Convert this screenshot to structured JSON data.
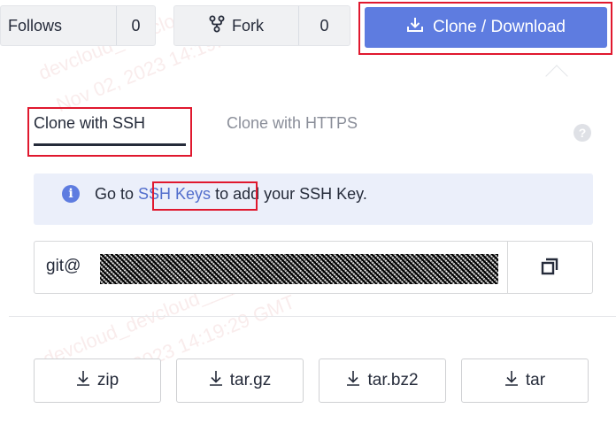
{
  "toolbar": {
    "follows_label": "Follows",
    "follows_count": "0",
    "fork_label": "Fork",
    "fork_count": "0",
    "clone_label": "Clone / Download"
  },
  "popover": {
    "tabs": [
      "Clone with SSH",
      "Clone with HTTPS"
    ],
    "active_tab": "Clone with SSH",
    "help_symbol": "?",
    "info": {
      "before": "Go to ",
      "link": "SSH Keys",
      "after": " to add your SSH Key."
    },
    "url_prefix": "git@",
    "downloads": [
      "zip",
      "tar.gz",
      "tar.bz2",
      "tar"
    ]
  },
  "watermark": {
    "lines": [
      "devcloud_devcloud_",
      "Nov 02, 2023 14:19:29 GMT",
      "devcloud_devcloud_____255_01",
      "Nov 02, 2023 14:19:29 GMT"
    ]
  },
  "icons": {
    "clone": "download-icon",
    "fork": "fork-icon",
    "info": "info-icon",
    "help": "help-icon",
    "copy": "copy-icon",
    "download": "download-arrow-icon"
  },
  "colors": {
    "accent": "#5e7ce0",
    "highlight": "#e0182e",
    "info_background": "#ebeffa",
    "link": "#526ecc"
  }
}
